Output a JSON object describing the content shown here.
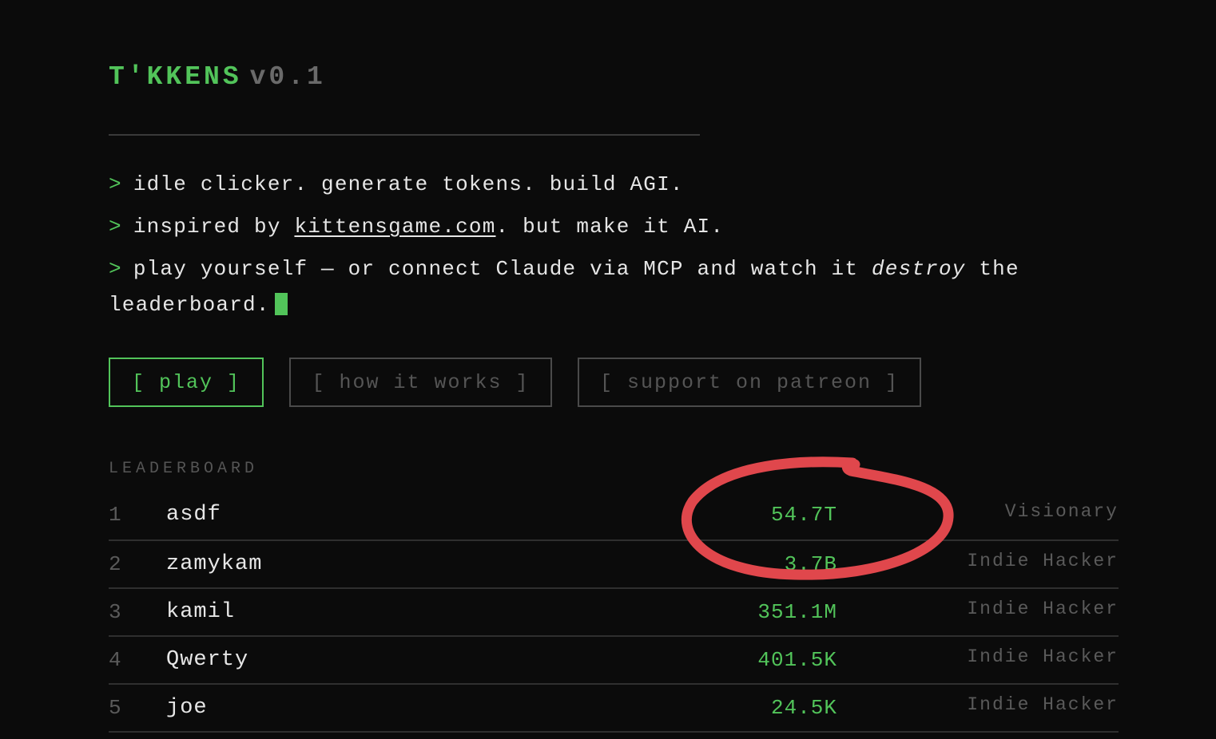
{
  "header": {
    "name": "T'KKENS",
    "version": "v0.1"
  },
  "intro": {
    "prompt": ">",
    "line1": "idle clicker. generate tokens. build AGI.",
    "line2_pre": "inspired by ",
    "line2_link": "kittensgame.com",
    "line2_post": ". but make it AI.",
    "line3_pre": "play yourself — or connect Claude via MCP and watch it ",
    "line3_em": "destroy",
    "line3_post": " the",
    "line4": "leaderboard."
  },
  "buttons": {
    "play": "[ play ]",
    "how": "[ how it works ]",
    "patreon": "[ support on patreon ]"
  },
  "leaderboard": {
    "heading": "LEADERBOARD",
    "rows": [
      {
        "rank": "1",
        "name": "asdf",
        "score": "54.7T",
        "title": "Visionary"
      },
      {
        "rank": "2",
        "name": "zamykam",
        "score": "3.7B",
        "title": "Indie Hacker"
      },
      {
        "rank": "3",
        "name": "kamil",
        "score": "351.1M",
        "title": "Indie Hacker"
      },
      {
        "rank": "4",
        "name": "Qwerty",
        "score": "401.5K",
        "title": "Indie Hacker"
      },
      {
        "rank": "5",
        "name": "joe",
        "score": "24.5K",
        "title": "Indie Hacker"
      }
    ]
  },
  "colors": {
    "accent": "#52c45a",
    "background": "#0b0b0b",
    "annotation": "#e0474c"
  }
}
